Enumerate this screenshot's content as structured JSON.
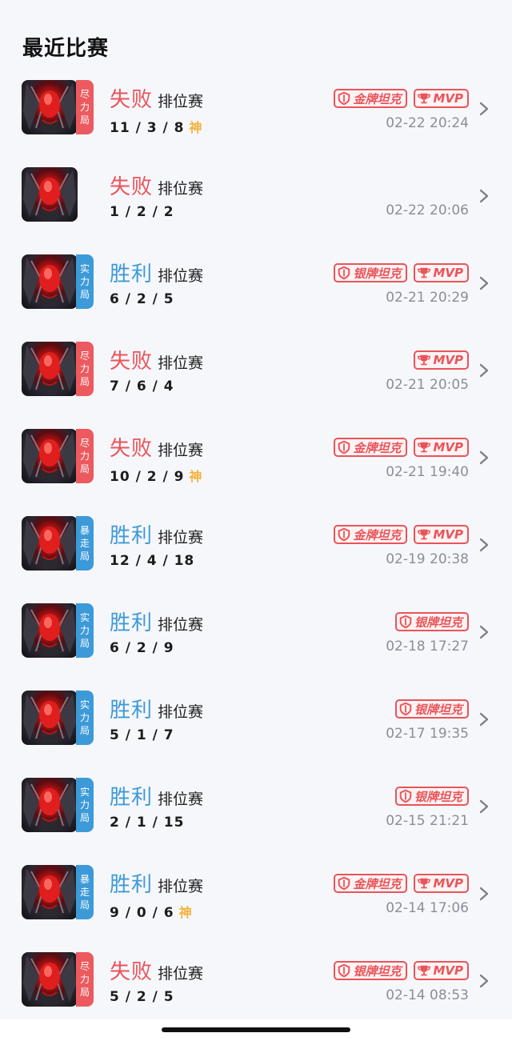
{
  "section": {
    "title": "最近比赛"
  },
  "colors": {
    "lose": "#ea5459",
    "win": "#3d9ad8",
    "badge": "#e9545a",
    "god": "#f3b23a",
    "time": "#8a8e99"
  },
  "icons": {
    "chevron": "chevron-right-icon",
    "shield": "shield-icon",
    "trophy": "trophy-icon"
  },
  "matches": [
    {
      "tag": [
        "尽",
        "力",
        "局"
      ],
      "tag_color": "red",
      "result": "失败",
      "result_type": "lose",
      "mode": "排位赛",
      "kda": "11 / 3 / 8",
      "god": "神",
      "badges": [
        "金牌坦克",
        "MVP"
      ],
      "time": "02-22 20:24"
    },
    {
      "tag": [],
      "tag_color": "",
      "result": "失败",
      "result_type": "lose",
      "mode": "排位赛",
      "kda": "1 / 2 / 2",
      "god": "",
      "badges": [],
      "time": "02-22 20:06"
    },
    {
      "tag": [
        "实",
        "力",
        "局"
      ],
      "tag_color": "blue",
      "result": "胜利",
      "result_type": "win",
      "mode": "排位赛",
      "kda": "6 / 2 / 5",
      "god": "",
      "badges": [
        "银牌坦克",
        "MVP"
      ],
      "time": "02-21 20:29"
    },
    {
      "tag": [
        "尽",
        "力",
        "局"
      ],
      "tag_color": "red",
      "result": "失败",
      "result_type": "lose",
      "mode": "排位赛",
      "kda": "7 / 6 / 4",
      "god": "",
      "badges": [
        "MVP"
      ],
      "time": "02-21 20:05"
    },
    {
      "tag": [
        "尽",
        "力",
        "局"
      ],
      "tag_color": "red",
      "result": "失败",
      "result_type": "lose",
      "mode": "排位赛",
      "kda": "10 / 2 / 9",
      "god": "神",
      "badges": [
        "金牌坦克",
        "MVP"
      ],
      "time": "02-21 19:40"
    },
    {
      "tag": [
        "暴",
        "走",
        "局"
      ],
      "tag_color": "blue",
      "result": "胜利",
      "result_type": "win",
      "mode": "排位赛",
      "kda": "12 / 4 / 18",
      "god": "",
      "badges": [
        "金牌坦克",
        "MVP"
      ],
      "time": "02-19 20:38"
    },
    {
      "tag": [
        "实",
        "力",
        "局"
      ],
      "tag_color": "blue",
      "result": "胜利",
      "result_type": "win",
      "mode": "排位赛",
      "kda": "6 / 2 / 9",
      "god": "",
      "badges": [
        "银牌坦克"
      ],
      "time": "02-18 17:27"
    },
    {
      "tag": [
        "实",
        "力",
        "局"
      ],
      "tag_color": "blue",
      "result": "胜利",
      "result_type": "win",
      "mode": "排位赛",
      "kda": "5 / 1 / 7",
      "god": "",
      "badges": [
        "银牌坦克"
      ],
      "time": "02-17 19:35"
    },
    {
      "tag": [
        "实",
        "力",
        "局"
      ],
      "tag_color": "blue",
      "result": "胜利",
      "result_type": "win",
      "mode": "排位赛",
      "kda": "2 / 1 / 15",
      "god": "",
      "badges": [
        "银牌坦克"
      ],
      "time": "02-15 21:21"
    },
    {
      "tag": [
        "暴",
        "走",
        "局"
      ],
      "tag_color": "blue",
      "result": "胜利",
      "result_type": "win",
      "mode": "排位赛",
      "kda": "9 / 0 / 6",
      "god": "神",
      "badges": [
        "金牌坦克",
        "MVP"
      ],
      "time": "02-14 17:06"
    },
    {
      "tag": [
        "尽",
        "力",
        "局"
      ],
      "tag_color": "red",
      "result": "失败",
      "result_type": "lose",
      "mode": "排位赛",
      "kda": "5 / 2 / 5",
      "god": "",
      "badges": [
        "银牌坦克",
        "MVP"
      ],
      "time": "02-14 08:53"
    }
  ]
}
